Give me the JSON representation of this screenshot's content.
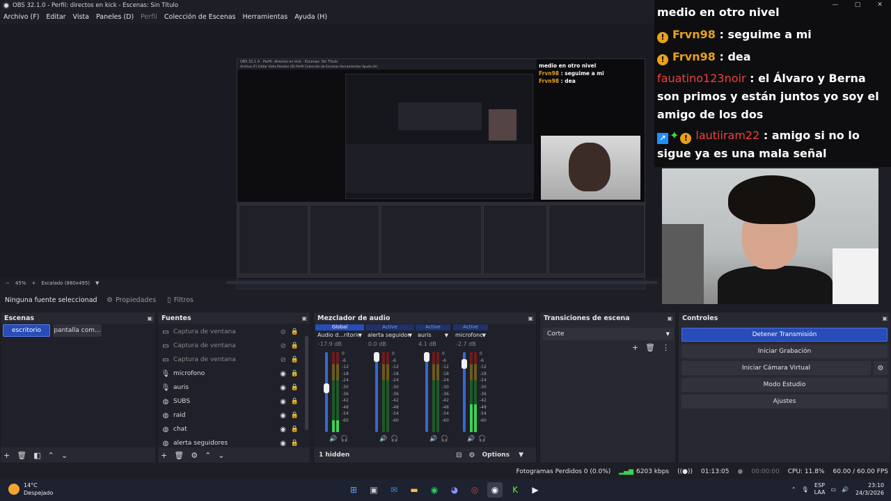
{
  "window": {
    "title": "OBS 32.1.0 - Perfil: directos en kick - Escenas: Sin Título",
    "minimize": "—",
    "maximize": "▢",
    "close": "✕"
  },
  "menu": [
    {
      "label": "Archivo (F)",
      "dim": false
    },
    {
      "label": "Editar",
      "dim": false
    },
    {
      "label": "Vista",
      "dim": false
    },
    {
      "label": "Paneles (D)",
      "dim": false
    },
    {
      "label": "Perfil",
      "dim": true
    },
    {
      "label": "Colección de Escenas",
      "dim": false
    },
    {
      "label": "Herramientas",
      "dim": false
    },
    {
      "label": "Ayuda (H)",
      "dim": false
    }
  ],
  "preview": {
    "zoom": "45%",
    "scaling": "Escalado (880x495)",
    "nested_title": "OBS 32.1.0 - Perfil: directos en kick - Escenas: Sin Título",
    "nested_menu": "Archivo (F)   Editar   Vista   Paneles (D)   Perfil   Colección de Escenas   Herramientas   Ayuda (H)"
  },
  "chat": {
    "lines": [
      {
        "badges": "",
        "user": "",
        "user_color": "none",
        "text": "medio en otro nivel"
      },
      {
        "badges": "yellow",
        "user": "Frvn98",
        "user_color": "yellow",
        "text": ": seguime a mi"
      },
      {
        "badges": "yellow",
        "user": "Frvn98",
        "user_color": "yellow",
        "text": ": dea"
      },
      {
        "badges": "",
        "user": "fauatino123noir",
        "user_color": "red",
        "text": ": el Álvaro y Berna son primos y están juntos yo soy el amigo de los dos"
      },
      {
        "badges": "multi",
        "user": "lautiiram22",
        "user_color": "red",
        "text": ": amigo si no lo sigue ya es una mala señal"
      }
    ]
  },
  "source_bar": {
    "no_source": "Ninguna fuente seleccionad",
    "properties": "Propiedades",
    "filters": "Filtros"
  },
  "scenes": {
    "title": "Escenas",
    "items": [
      {
        "label": "escritorio",
        "active": true
      },
      {
        "label": "pantalla com...",
        "active": false
      }
    ]
  },
  "sources": {
    "title": "Fuentes",
    "items": [
      {
        "label": "Captura de ventana",
        "icon": "window-capture-icon",
        "glyph": "▭",
        "visible": false
      },
      {
        "label": "Captura de ventana",
        "icon": "window-capture-icon",
        "glyph": "▭",
        "visible": false
      },
      {
        "label": "Captura de ventana",
        "icon": "window-capture-icon",
        "glyph": "▭",
        "visible": false
      },
      {
        "label": "microfono",
        "icon": "microphone-icon",
        "glyph": "🎙",
        "visible": true
      },
      {
        "label": "auris",
        "icon": "microphone-icon",
        "glyph": "🎙",
        "visible": true
      },
      {
        "label": "SUBS",
        "icon": "browser-icon",
        "glyph": "◍",
        "visible": true
      },
      {
        "label": "raid",
        "icon": "browser-icon",
        "glyph": "◍",
        "visible": true
      },
      {
        "label": "chat",
        "icon": "browser-icon",
        "glyph": "◍",
        "visible": true
      },
      {
        "label": "alerta seguidores",
        "icon": "browser-icon",
        "glyph": "◍",
        "visible": true
      }
    ]
  },
  "mixer": {
    "title": "Mezclador de audio",
    "hidden_label": "1 hidden",
    "options_label": "Options",
    "scale": [
      "0",
      "-6",
      "-12",
      "-18",
      "-24",
      "-30",
      "-36",
      "-42",
      "-48",
      "-54",
      "-60"
    ],
    "channels": [
      {
        "tag": "Global",
        "tag_type": "global",
        "name": "Audio d...ritorio",
        "db": "-17.9 dB",
        "fader": 0.55,
        "level": 0.15
      },
      {
        "tag": "Active",
        "tag_type": "active",
        "name": "alerta seguidores",
        "db": "0.0 dB",
        "fader": 1.0,
        "level": 0.0
      },
      {
        "tag": "Active",
        "tag_type": "active",
        "name": "auris",
        "db": "4.1 dB",
        "fader": 1.0,
        "level": 0.0
      },
      {
        "tag": "Active",
        "tag_type": "active",
        "name": "microfono",
        "db": "-2.7 dB",
        "fader": 0.9,
        "level": 0.35
      }
    ]
  },
  "transitions": {
    "title": "Transiciones de escena",
    "selected": "Corte"
  },
  "controls": {
    "title": "Controles",
    "buttons": [
      {
        "label": "Detener Transmisión",
        "primary": true
      },
      {
        "label": "Iniciar Grabación",
        "primary": false
      },
      {
        "label": "Iniciar Cámara Virtual",
        "primary": false
      },
      {
        "label": "Modo Estudio",
        "primary": false
      },
      {
        "label": "Ajustes",
        "primary": false
      }
    ]
  },
  "status": {
    "dropped": "Fotogramas Perdidos 0 (0.0%)",
    "bitrate": "6203 kbps",
    "stream_time": "01:13:05",
    "rec_time": "00:00:00",
    "cpu": "CPU: 11.8%",
    "fps": "60.00 / 60.00 FPS"
  },
  "taskbar": {
    "temp": "14°C",
    "weather": "Despejado",
    "lang1": "ESP",
    "lang2": "LAA",
    "time": "23:10",
    "date": "24/3/2026"
  },
  "colors": {
    "accent": "#284cb8",
    "panel": "#272831",
    "background": "#1d1e26",
    "chat_yellow": "#e8a21a",
    "chat_red": "#f0413e"
  }
}
